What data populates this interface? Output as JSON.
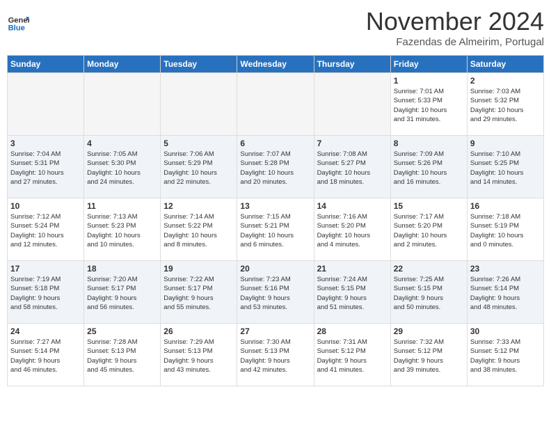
{
  "header": {
    "logo_line1": "General",
    "logo_line2": "Blue",
    "month": "November 2024",
    "location": "Fazendas de Almeirim, Portugal"
  },
  "weekdays": [
    "Sunday",
    "Monday",
    "Tuesday",
    "Wednesday",
    "Thursday",
    "Friday",
    "Saturday"
  ],
  "weeks": [
    [
      {
        "day": "",
        "info": ""
      },
      {
        "day": "",
        "info": ""
      },
      {
        "day": "",
        "info": ""
      },
      {
        "day": "",
        "info": ""
      },
      {
        "day": "",
        "info": ""
      },
      {
        "day": "1",
        "info": "Sunrise: 7:01 AM\nSunset: 5:33 PM\nDaylight: 10 hours\nand 31 minutes."
      },
      {
        "day": "2",
        "info": "Sunrise: 7:03 AM\nSunset: 5:32 PM\nDaylight: 10 hours\nand 29 minutes."
      }
    ],
    [
      {
        "day": "3",
        "info": "Sunrise: 7:04 AM\nSunset: 5:31 PM\nDaylight: 10 hours\nand 27 minutes."
      },
      {
        "day": "4",
        "info": "Sunrise: 7:05 AM\nSunset: 5:30 PM\nDaylight: 10 hours\nand 24 minutes."
      },
      {
        "day": "5",
        "info": "Sunrise: 7:06 AM\nSunset: 5:29 PM\nDaylight: 10 hours\nand 22 minutes."
      },
      {
        "day": "6",
        "info": "Sunrise: 7:07 AM\nSunset: 5:28 PM\nDaylight: 10 hours\nand 20 minutes."
      },
      {
        "day": "7",
        "info": "Sunrise: 7:08 AM\nSunset: 5:27 PM\nDaylight: 10 hours\nand 18 minutes."
      },
      {
        "day": "8",
        "info": "Sunrise: 7:09 AM\nSunset: 5:26 PM\nDaylight: 10 hours\nand 16 minutes."
      },
      {
        "day": "9",
        "info": "Sunrise: 7:10 AM\nSunset: 5:25 PM\nDaylight: 10 hours\nand 14 minutes."
      }
    ],
    [
      {
        "day": "10",
        "info": "Sunrise: 7:12 AM\nSunset: 5:24 PM\nDaylight: 10 hours\nand 12 minutes."
      },
      {
        "day": "11",
        "info": "Sunrise: 7:13 AM\nSunset: 5:23 PM\nDaylight: 10 hours\nand 10 minutes."
      },
      {
        "day": "12",
        "info": "Sunrise: 7:14 AM\nSunset: 5:22 PM\nDaylight: 10 hours\nand 8 minutes."
      },
      {
        "day": "13",
        "info": "Sunrise: 7:15 AM\nSunset: 5:21 PM\nDaylight: 10 hours\nand 6 minutes."
      },
      {
        "day": "14",
        "info": "Sunrise: 7:16 AM\nSunset: 5:20 PM\nDaylight: 10 hours\nand 4 minutes."
      },
      {
        "day": "15",
        "info": "Sunrise: 7:17 AM\nSunset: 5:20 PM\nDaylight: 10 hours\nand 2 minutes."
      },
      {
        "day": "16",
        "info": "Sunrise: 7:18 AM\nSunset: 5:19 PM\nDaylight: 10 hours\nand 0 minutes."
      }
    ],
    [
      {
        "day": "17",
        "info": "Sunrise: 7:19 AM\nSunset: 5:18 PM\nDaylight: 9 hours\nand 58 minutes."
      },
      {
        "day": "18",
        "info": "Sunrise: 7:20 AM\nSunset: 5:17 PM\nDaylight: 9 hours\nand 56 minutes."
      },
      {
        "day": "19",
        "info": "Sunrise: 7:22 AM\nSunset: 5:17 PM\nDaylight: 9 hours\nand 55 minutes."
      },
      {
        "day": "20",
        "info": "Sunrise: 7:23 AM\nSunset: 5:16 PM\nDaylight: 9 hours\nand 53 minutes."
      },
      {
        "day": "21",
        "info": "Sunrise: 7:24 AM\nSunset: 5:15 PM\nDaylight: 9 hours\nand 51 minutes."
      },
      {
        "day": "22",
        "info": "Sunrise: 7:25 AM\nSunset: 5:15 PM\nDaylight: 9 hours\nand 50 minutes."
      },
      {
        "day": "23",
        "info": "Sunrise: 7:26 AM\nSunset: 5:14 PM\nDaylight: 9 hours\nand 48 minutes."
      }
    ],
    [
      {
        "day": "24",
        "info": "Sunrise: 7:27 AM\nSunset: 5:14 PM\nDaylight: 9 hours\nand 46 minutes."
      },
      {
        "day": "25",
        "info": "Sunrise: 7:28 AM\nSunset: 5:13 PM\nDaylight: 9 hours\nand 45 minutes."
      },
      {
        "day": "26",
        "info": "Sunrise: 7:29 AM\nSunset: 5:13 PM\nDaylight: 9 hours\nand 43 minutes."
      },
      {
        "day": "27",
        "info": "Sunrise: 7:30 AM\nSunset: 5:13 PM\nDaylight: 9 hours\nand 42 minutes."
      },
      {
        "day": "28",
        "info": "Sunrise: 7:31 AM\nSunset: 5:12 PM\nDaylight: 9 hours\nand 41 minutes."
      },
      {
        "day": "29",
        "info": "Sunrise: 7:32 AM\nSunset: 5:12 PM\nDaylight: 9 hours\nand 39 minutes."
      },
      {
        "day": "30",
        "info": "Sunrise: 7:33 AM\nSunset: 5:12 PM\nDaylight: 9 hours\nand 38 minutes."
      }
    ]
  ]
}
